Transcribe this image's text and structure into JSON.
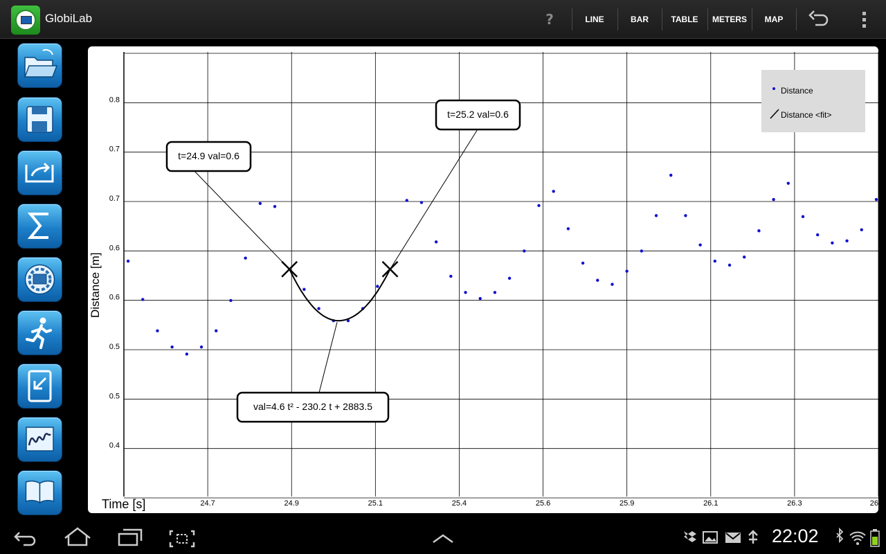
{
  "app": {
    "title": "GlobiLab"
  },
  "toolbar": {
    "help_label": "?",
    "line_label": "LINE",
    "bar_label": "BAR",
    "table_label": "TABLE",
    "meters_label": "METERS",
    "map_label": "MAP"
  },
  "sidebar": {
    "items": [
      {
        "name": "open-folder"
      },
      {
        "name": "save"
      },
      {
        "name": "export"
      },
      {
        "name": "statistics-sigma"
      },
      {
        "name": "device-globisens"
      },
      {
        "name": "running-activity"
      },
      {
        "name": "import-tablet"
      },
      {
        "name": "graph-analysis"
      },
      {
        "name": "book-help"
      }
    ]
  },
  "chart_data": {
    "type": "scatter",
    "xlabel": "Time [s]",
    "ylabel": "Distance [m]",
    "x_ticks": [
      "24.7",
      "24.9",
      "25.1",
      "25.4",
      "25.6",
      "25.9",
      "26.1",
      "26.3",
      "26"
    ],
    "y_ticks": [
      "0.8",
      "0.7",
      "0.7",
      "0.6",
      "0.6",
      "0.5",
      "0.5",
      "0.4"
    ],
    "xlim": [
      24.5,
      26.3
    ],
    "ylim": [
      0.375,
      0.815
    ],
    "legend_placement": "top-right",
    "legend": [
      {
        "name": "Distance",
        "marker": "dot",
        "color": "#1010d0"
      },
      {
        "name": "Distance <fit>",
        "marker": "line",
        "color": "#000000"
      }
    ],
    "series": [
      {
        "name": "Distance",
        "color": "#1010d0",
        "points": [
          {
            "x": 24.51,
            "y": 0.608
          },
          {
            "x": 24.545,
            "y": 0.57
          },
          {
            "x": 24.58,
            "y": 0.539
          },
          {
            "x": 24.615,
            "y": 0.523
          },
          {
            "x": 24.65,
            "y": 0.516
          },
          {
            "x": 24.685,
            "y": 0.523
          },
          {
            "x": 24.72,
            "y": 0.539
          },
          {
            "x": 24.755,
            "y": 0.569
          },
          {
            "x": 24.79,
            "y": 0.611
          },
          {
            "x": 24.825,
            "y": 0.665
          },
          {
            "x": 24.86,
            "y": 0.662
          },
          {
            "x": 24.93,
            "y": 0.58
          },
          {
            "x": 24.965,
            "y": 0.561
          },
          {
            "x": 25.0,
            "y": 0.549
          },
          {
            "x": 25.035,
            "y": 0.549
          },
          {
            "x": 25.07,
            "y": 0.561
          },
          {
            "x": 25.105,
            "y": 0.583
          },
          {
            "x": 25.175,
            "y": 0.668
          },
          {
            "x": 25.21,
            "y": 0.666
          },
          {
            "x": 25.245,
            "y": 0.627
          },
          {
            "x": 25.28,
            "y": 0.593
          },
          {
            "x": 25.315,
            "y": 0.577
          },
          {
            "x": 25.35,
            "y": 0.571
          },
          {
            "x": 25.385,
            "y": 0.577
          },
          {
            "x": 25.42,
            "y": 0.591
          },
          {
            "x": 25.455,
            "y": 0.618
          },
          {
            "x": 25.49,
            "y": 0.663
          },
          {
            "x": 25.525,
            "y": 0.677
          },
          {
            "x": 25.56,
            "y": 0.64
          },
          {
            "x": 25.595,
            "y": 0.606
          },
          {
            "x": 25.63,
            "y": 0.589
          },
          {
            "x": 25.665,
            "y": 0.585
          },
          {
            "x": 25.7,
            "y": 0.598
          },
          {
            "x": 25.735,
            "y": 0.618
          },
          {
            "x": 25.77,
            "y": 0.653
          },
          {
            "x": 25.805,
            "y": 0.693
          },
          {
            "x": 25.84,
            "y": 0.653
          },
          {
            "x": 25.875,
            "y": 0.624
          },
          {
            "x": 25.91,
            "y": 0.608
          },
          {
            "x": 25.945,
            "y": 0.604
          },
          {
            "x": 25.98,
            "y": 0.612
          },
          {
            "x": 26.015,
            "y": 0.638
          },
          {
            "x": 26.05,
            "y": 0.669
          },
          {
            "x": 26.085,
            "y": 0.685
          },
          {
            "x": 26.12,
            "y": 0.652
          },
          {
            "x": 26.155,
            "y": 0.634
          },
          {
            "x": 26.19,
            "y": 0.626
          },
          {
            "x": 26.225,
            "y": 0.628
          },
          {
            "x": 26.26,
            "y": 0.639
          },
          {
            "x": 26.295,
            "y": 0.669
          }
        ]
      }
    ],
    "fit": {
      "name": "Distance <fit>",
      "equation_label": "val=4.6 t² - 230.2 t + 2883.5",
      "x_start": 24.895,
      "x_end": 25.135,
      "y_start": 0.6,
      "y_min": 0.549,
      "x_min": 25.012,
      "y_end": 0.6
    },
    "markers": [
      {
        "label": "t=24.9 val=0.6",
        "x": 24.895,
        "y": 0.6
      },
      {
        "label": "t=25.2 val=0.6",
        "x": 25.135,
        "y": 0.6
      }
    ]
  },
  "status_bar": {
    "time": "22:02"
  }
}
